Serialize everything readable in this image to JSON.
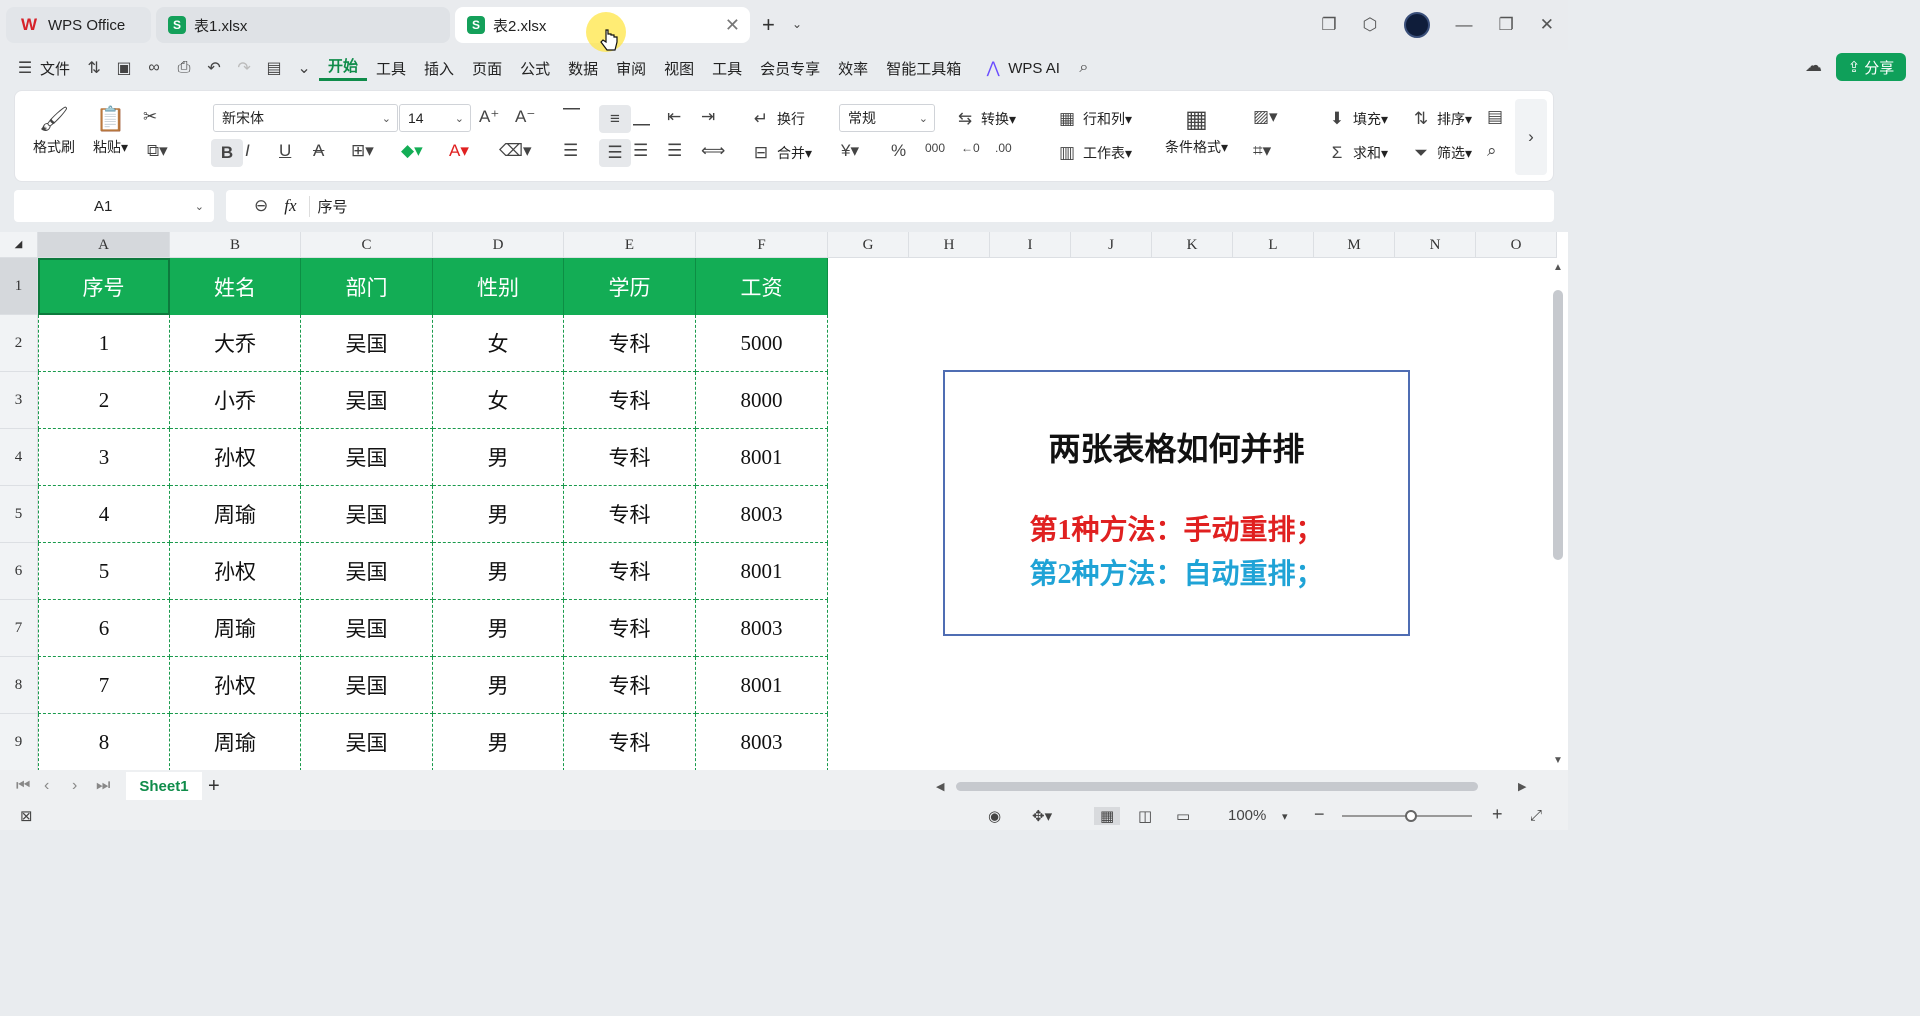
{
  "tabs": [
    {
      "label": "WPS Office"
    },
    {
      "label": "表1.xlsx"
    },
    {
      "label": "表2.xlsx"
    }
  ],
  "menu": {
    "file": "文件",
    "items": [
      "开始",
      "工具",
      "插入",
      "页面",
      "公式",
      "数据",
      "审阅",
      "视图",
      "工具",
      "会员专享",
      "效率",
      "智能工具箱"
    ],
    "ai": "WPS AI",
    "share": "分享"
  },
  "ribbon": {
    "format_painter": "格式刷",
    "paste": "粘贴",
    "font_name": "新宋体",
    "font_size": "14",
    "wrap": "换行",
    "merge": "合并",
    "number_format": "常规",
    "convert": "转换",
    "row_col": "行和列",
    "worksheet": "工作表",
    "cond_format": "条件格式",
    "fill": "填充",
    "sort": "排序",
    "sum": "求和",
    "filter": "筛选"
  },
  "formula_bar": {
    "cell_ref": "A1",
    "fx": "fx",
    "content": "序号"
  },
  "columns": [
    "A",
    "B",
    "C",
    "D",
    "E",
    "F",
    "G",
    "H",
    "I",
    "J",
    "K",
    "L",
    "M",
    "N",
    "O"
  ],
  "rows": [
    "1",
    "2",
    "3",
    "4",
    "5",
    "6",
    "7",
    "8",
    "9"
  ],
  "table": {
    "headers": [
      "序号",
      "姓名",
      "部门",
      "性别",
      "学历",
      "工资"
    ],
    "data": [
      [
        "1",
        "大乔",
        "吴国",
        "女",
        "专科",
        "5000"
      ],
      [
        "2",
        "小乔",
        "吴国",
        "女",
        "专科",
        "8000"
      ],
      [
        "3",
        "孙权",
        "吴国",
        "男",
        "专科",
        "8001"
      ],
      [
        "4",
        "周瑜",
        "吴国",
        "男",
        "专科",
        "8003"
      ],
      [
        "5",
        "孙权",
        "吴国",
        "男",
        "专科",
        "8001"
      ],
      [
        "6",
        "周瑜",
        "吴国",
        "男",
        "专科",
        "8003"
      ],
      [
        "7",
        "孙权",
        "吴国",
        "男",
        "专科",
        "8001"
      ],
      [
        "8",
        "周瑜",
        "吴国",
        "男",
        "专科",
        "8003"
      ]
    ]
  },
  "note": {
    "title": "两张表格如何并排",
    "line1": "第1种方法：手动重排；",
    "line2": "第2种方法：自动重排；"
  },
  "sheet_tab": "Sheet1",
  "status": {
    "zoom": "100%"
  },
  "colors": {
    "accent": "#0f8c4a",
    "header_fill": "#13ad55",
    "line1": "#e02020",
    "line2": "#1fa3d6"
  }
}
